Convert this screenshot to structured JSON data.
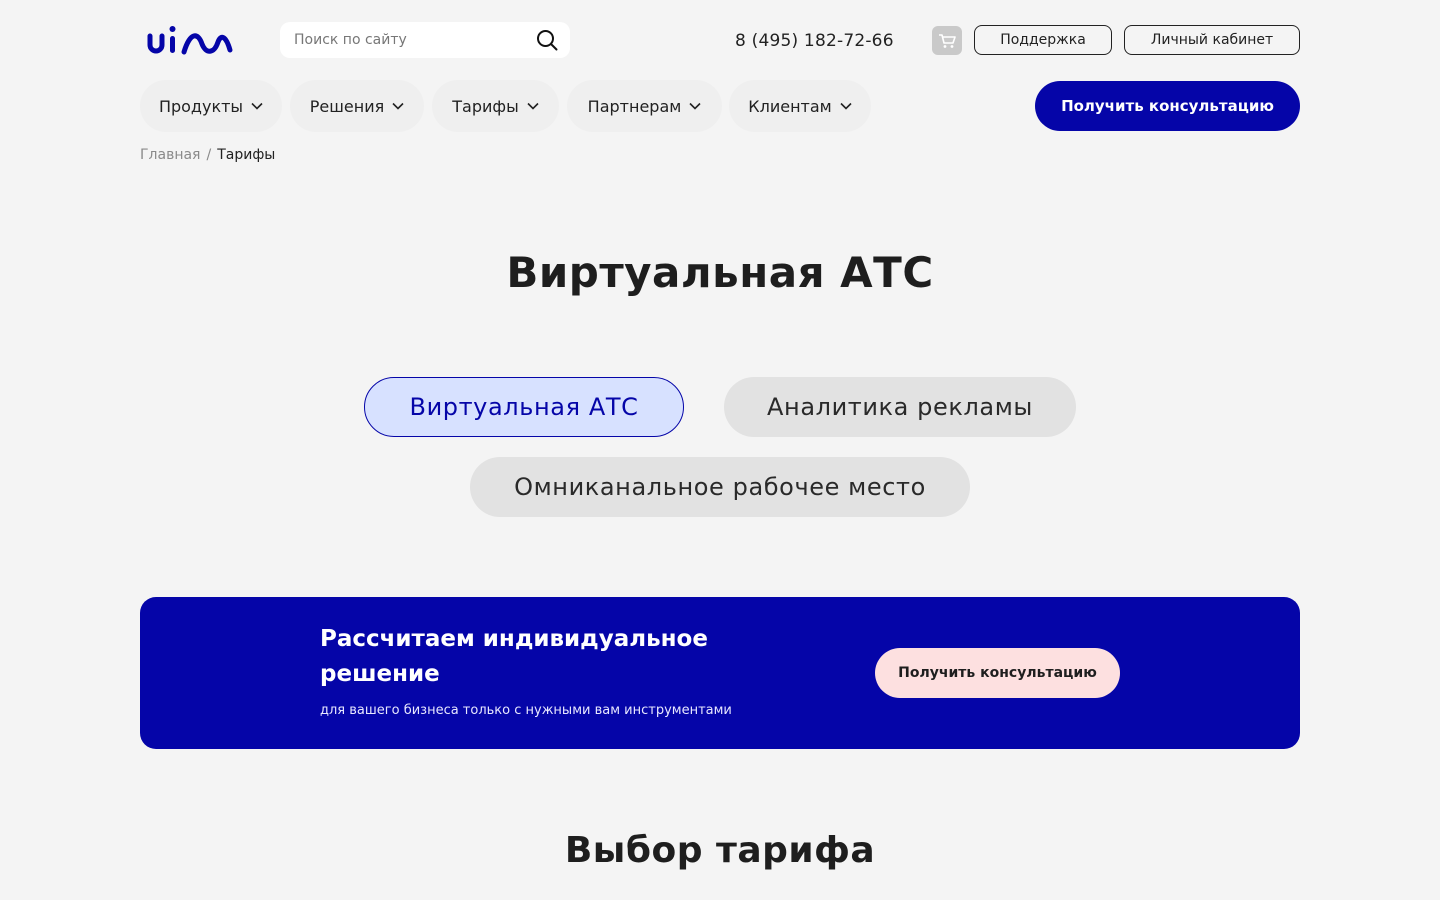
{
  "header": {
    "logo_text": "uis",
    "search": {
      "placeholder": "Поиск по сайту"
    },
    "phone": "8 (495) 182-72-66",
    "support_label": "Поддержка",
    "cabinet_label": "Личный кабинет"
  },
  "nav": {
    "items": [
      {
        "label": "Продукты"
      },
      {
        "label": "Решения"
      },
      {
        "label": "Тарифы"
      },
      {
        "label": "Партнерам"
      },
      {
        "label": "Клиентам"
      }
    ],
    "cta_label": "Получить консультацию"
  },
  "breadcrumb": {
    "home": "Главная",
    "separator": "/",
    "current": "Тарифы"
  },
  "page_title": "Виртуальная АТС",
  "product_tabs": [
    {
      "label": "Виртуальная АТС",
      "active": true
    },
    {
      "label": "Аналитика рекламы",
      "active": false
    },
    {
      "label": "Омниканальное рабочее место",
      "active": false
    }
  ],
  "banner": {
    "title": "Рассчитаем индивидуальное решение",
    "subtitle": "для вашего бизнеса только с нужными вам инструментами",
    "cta_label": "Получить консультацию"
  },
  "section_title": "Выбор тарифа",
  "colors": {
    "brand": "#0505a8",
    "background": "#f4f4f4",
    "active_tab_bg": "#d7e1ff",
    "pink_button": "#fde0e0"
  },
  "icons": {
    "search": "search-icon",
    "cart": "cart-icon",
    "chevron": "chevron-down-icon"
  }
}
